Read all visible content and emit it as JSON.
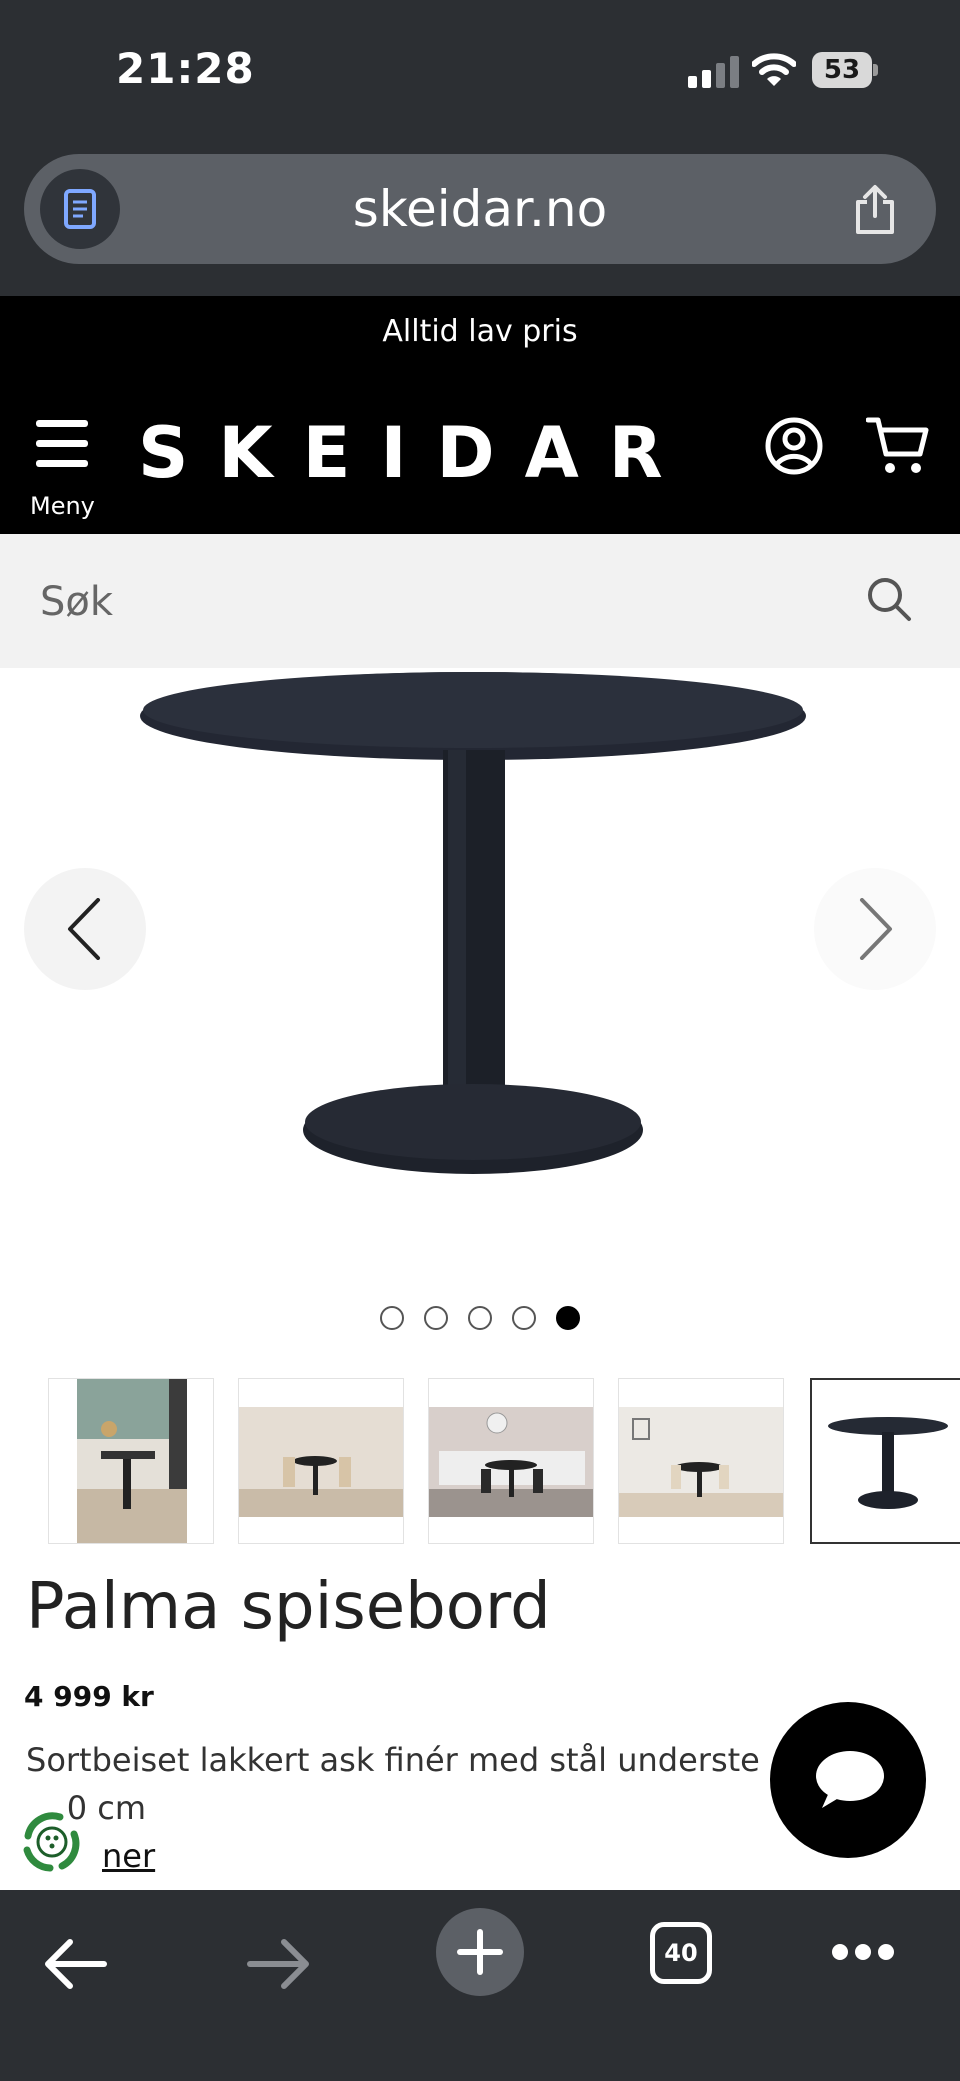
{
  "status_bar": {
    "time": "21:28",
    "battery": "53"
  },
  "browser": {
    "url": "skeidar.no",
    "open_tabs": "40"
  },
  "promo": {
    "text": "Alltid lav pris"
  },
  "header": {
    "logo": "SKEIDAR",
    "menu_label": "Meny"
  },
  "search": {
    "placeholder": "Søk"
  },
  "gallery": {
    "total_images": 5,
    "active_index": 4
  },
  "product": {
    "title": "Palma spisebord",
    "price": "4 999 kr",
    "description_line1": "Sortbeiset lakkert ask finér med stål underste",
    "description_line2": "    0 cm",
    "more_link": "ner"
  },
  "colors": {
    "chrome": "#2c2f33",
    "header": "#000000",
    "search_bg": "#f2f2f2",
    "table": "#1c2028"
  }
}
